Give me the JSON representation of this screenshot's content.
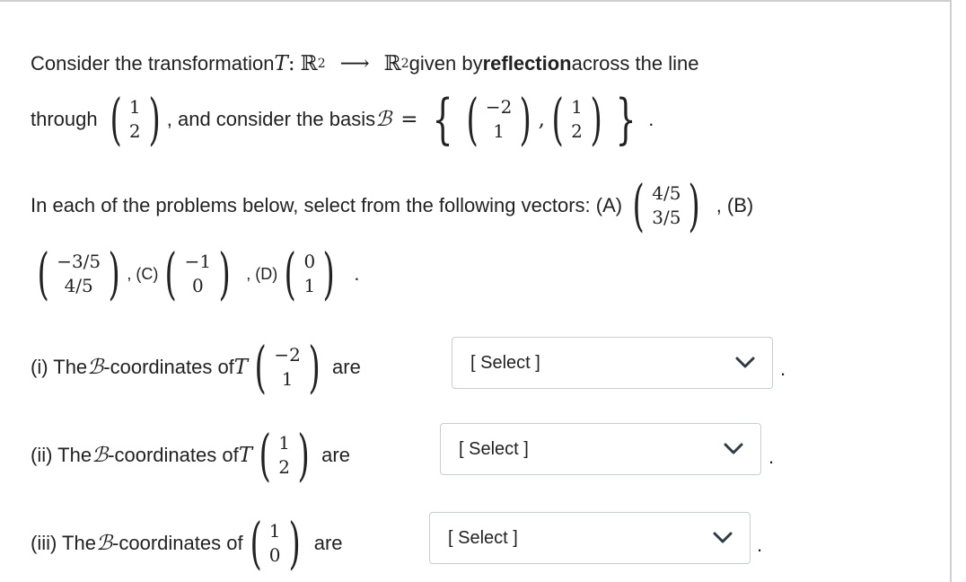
{
  "intro": {
    "t1": "Consider the transformation ",
    "T": "T",
    "colon": ":",
    "R": "ℝ",
    "sup2": "2",
    "arrow": "⟶",
    "t2": " given by ",
    "bold": "reflection",
    "t3": " across the line",
    "through": "through",
    "line_vec": [
      "1",
      "2"
    ],
    "t4": ", and consider the basis ",
    "B": "ℬ",
    "eq": "=",
    "basis_v1": [
      "−2",
      "1"
    ],
    "basis_v2": [
      "1",
      "2"
    ],
    "comma": ",",
    "dot": "."
  },
  "choices": {
    "text": "In each of the problems below, select from the following vectors: (A)",
    "A": [
      "4/5",
      "3/5"
    ],
    "labelB": ", (B)",
    "B": [
      "−3/5",
      "4/5"
    ],
    "labelC": ", (C)",
    "C": [
      "−1",
      "0"
    ],
    "labelD": ", (D)",
    "D": [
      "0",
      "1"
    ],
    "dot": "."
  },
  "questions": [
    {
      "prefix": "(i) The ",
      "B": "ℬ",
      "mid": " -coordinates of ",
      "T": "T",
      "vec": [
        "−2",
        "1"
      ],
      "are": "are",
      "select_label": "[ Select ]"
    },
    {
      "prefix": "(ii) The ",
      "B": "ℬ",
      "mid": " -coordinates of ",
      "T": "T",
      "vec": [
        "1",
        "2"
      ],
      "are": "are",
      "select_label": "[ Select ]"
    },
    {
      "prefix": "(iii) The ",
      "B": "ℬ",
      "mid": " -coordinates of",
      "T": "",
      "vec": [
        "1",
        "0"
      ],
      "are": "are",
      "select_label": "[ Select ]"
    }
  ],
  "period": ".",
  "icons": {
    "dropdown": "chevron-down-icon"
  },
  "colors": {
    "border": "#c7cdd1",
    "text": "#222222"
  }
}
